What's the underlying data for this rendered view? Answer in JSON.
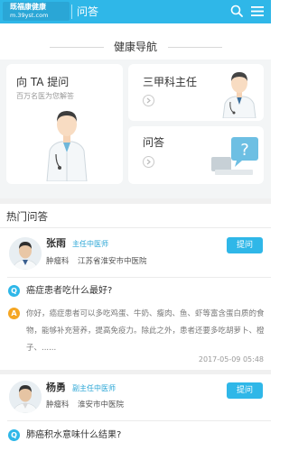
{
  "header": {
    "logo_name": "既福康健康",
    "logo_url": "m.39yst.com",
    "title": "问答"
  },
  "nav": {
    "title": "健康导航",
    "cards": [
      {
        "title": "向 TA 提问",
        "subtitle": "百万名医为您解答"
      },
      {
        "title": "三甲科主任"
      },
      {
        "title": "问答"
      }
    ]
  },
  "hot": {
    "title": "热门问答",
    "items": [
      {
        "doctor_name": "张雨",
        "doctor_title": "主任中医师",
        "dept": "肿瘤科",
        "hospital": "江苏省淮安市中医院",
        "ask_label": "提问",
        "question": "癌症患者吃什么最好?",
        "answer": "你好，癌症患者可以多吃鸡蛋、牛奶、瘦肉、鱼、虾等富含蛋白质的食物，能够补充营养，提高免疫力。除此之外，患者还要多吃胡萝卜、橙子、......",
        "time": "2017-05-09 05:48"
      },
      {
        "doctor_name": "杨勇",
        "doctor_title": "副主任中医师",
        "dept": "肿瘤科",
        "hospital": "淮安市中医院",
        "ask_label": "提问",
        "question": "肺癌积水意味什么结果?"
      }
    ]
  },
  "badges": {
    "q": "Q",
    "a": "A"
  },
  "colors": {
    "brand": "#2fb7e8",
    "answer_badge": "#f5a623",
    "doctor_title": "#2aa6d6"
  }
}
